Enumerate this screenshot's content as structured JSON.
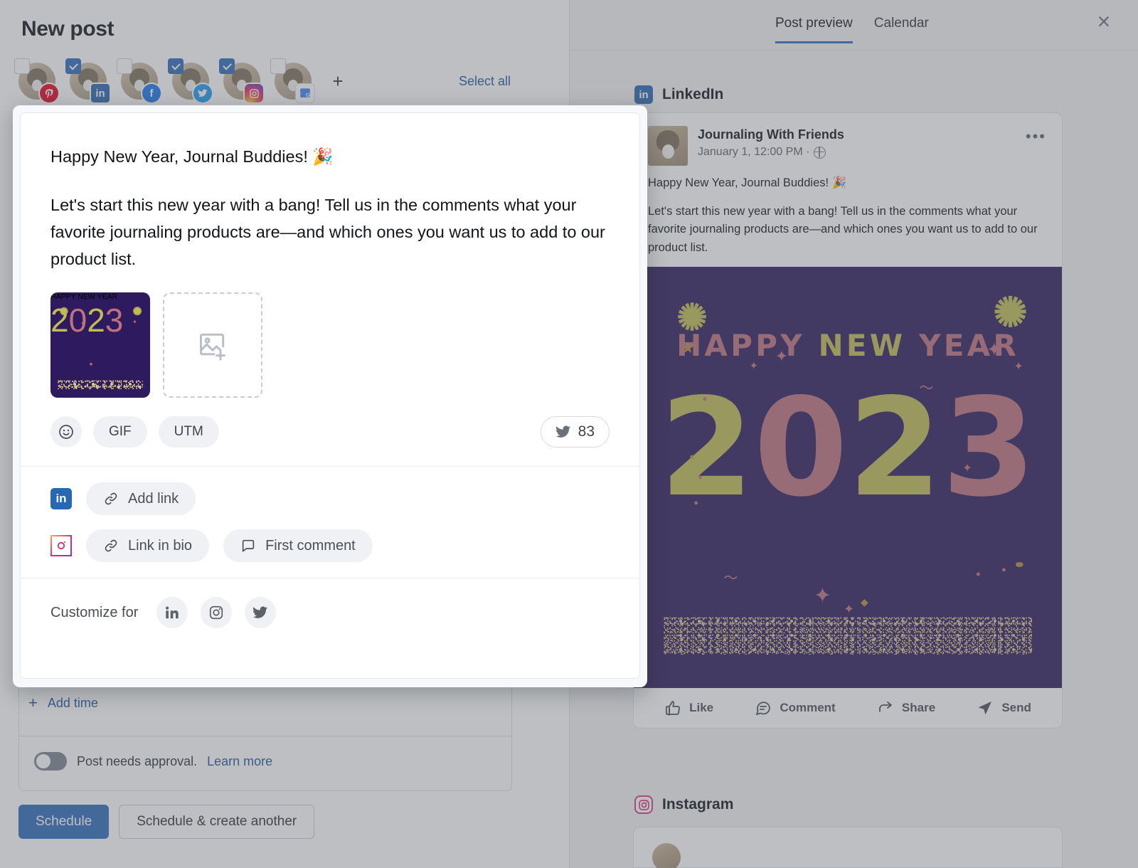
{
  "window": {
    "title": "New post",
    "close_label": "×"
  },
  "accounts": {
    "select_all_label": "Select all",
    "add_label": "+",
    "items": [
      {
        "network": "pinterest",
        "icon": "pinterest-icon",
        "checked": false,
        "glyph": "𝐏"
      },
      {
        "network": "linkedin",
        "icon": "linkedin-icon",
        "checked": true,
        "glyph": "in"
      },
      {
        "network": "facebook",
        "icon": "facebook-icon",
        "checked": false,
        "glyph": "f"
      },
      {
        "network": "twitter",
        "icon": "twitter-icon",
        "checked": true,
        "glyph": ""
      },
      {
        "network": "instagram",
        "icon": "instagram-icon",
        "checked": true,
        "glyph": ""
      },
      {
        "network": "gbusiness",
        "icon": "google-business-icon",
        "checked": false,
        "glyph": "G"
      }
    ]
  },
  "composer": {
    "line1": "Happy New Year, Journal Buddies! 🎉",
    "line2": "Let's start this new year with a bang! Tell us in the comments what your favorite journaling products are—and which ones you want us to add to our product list.",
    "media": {
      "thumbnail_alt": "Happy New Year 2023 graphic",
      "add_media_label": "add-image"
    },
    "chips": [
      {
        "id": "emoji",
        "label": "",
        "icon": "emoji-icon"
      },
      {
        "id": "gif",
        "label": "GIF",
        "icon": "gif-icon"
      },
      {
        "id": "utm",
        "label": "UTM",
        "icon": "utm-icon"
      }
    ],
    "counter": {
      "network": "twitter",
      "value": "83"
    },
    "link_rows": [
      {
        "network": "linkedin",
        "buttons": [
          {
            "label": "Add link",
            "icon": "link-icon"
          }
        ]
      },
      {
        "network": "instagram",
        "buttons": [
          {
            "label": "Link in bio",
            "icon": "link-icon"
          },
          {
            "label": "First comment",
            "icon": "comment-icon"
          }
        ]
      }
    ],
    "customize": {
      "label": "Customize for",
      "networks": [
        "linkedin",
        "instagram",
        "twitter"
      ]
    }
  },
  "schedule": {
    "add_time_label": "Add time",
    "add_time_plus": "+",
    "approval_text": "Post needs approval.",
    "learn_more_label": "Learn more",
    "approval_enabled": false,
    "primary_button": "Schedule",
    "secondary_button": "Schedule & create another"
  },
  "preview": {
    "tabs": [
      {
        "label": "Post preview",
        "active": true
      },
      {
        "label": "Calendar",
        "active": false
      }
    ],
    "networks": [
      {
        "name": "LinkedIn",
        "icon": "linkedin-icon",
        "post": {
          "author": "Journaling With Friends",
          "meta": "January 1, 12:00 PM ·",
          "visibility_icon": "globe-icon",
          "more_icon": "more-options-icon",
          "line1": "Happy New Year, Journal Buddies! 🎉",
          "line2": "Let's start this new year with a bang! Tell us in the comments what your favorite journaling products are—and which ones you want us to add to our product list.",
          "actions": [
            {
              "label": "Like",
              "icon": "thumbs-up-icon"
            },
            {
              "label": "Comment",
              "icon": "comment-icon"
            },
            {
              "label": "Share",
              "icon": "share-icon"
            },
            {
              "label": "Send",
              "icon": "send-icon"
            }
          ]
        }
      },
      {
        "name": "Instagram",
        "icon": "instagram-icon"
      }
    ]
  },
  "artwork": {
    "headline_part1": "HAPPY",
    "headline_part2": "NEW",
    "headline_part3": "YEAR",
    "year": "2023",
    "year_digits": [
      "2",
      "0",
      "2",
      "3"
    ],
    "colors": {
      "background": "#2e1a5e",
      "pink": "#c0717f",
      "olive": "#c2bc55",
      "glitter": "#d8c48a"
    }
  },
  "colors": {
    "accent_blue": "#2b6cb8",
    "link_blue": "#1e56a0",
    "linkedin": "#2867b2",
    "twitter": "#1d9bf0",
    "facebook": "#1877f2",
    "pinterest": "#e60023"
  }
}
